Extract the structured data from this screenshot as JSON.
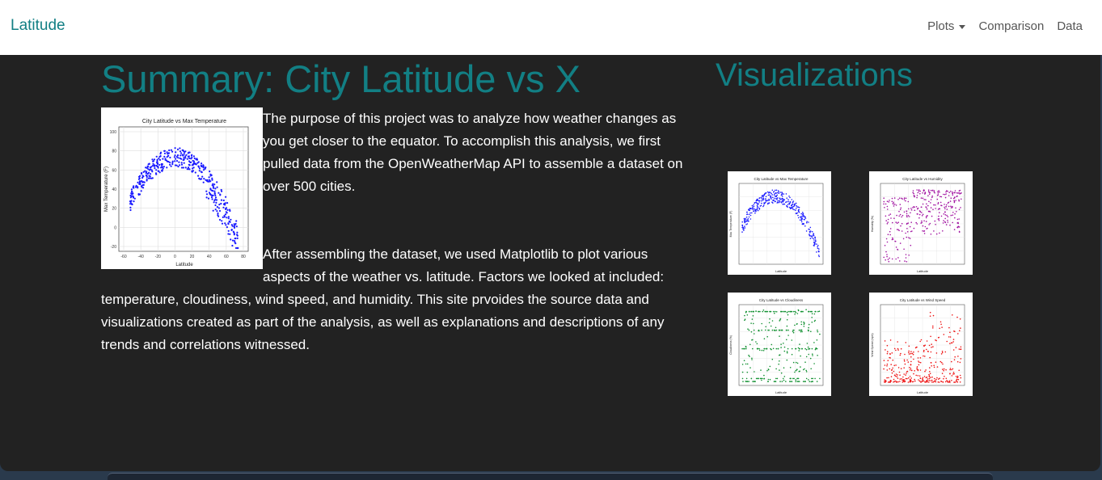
{
  "navbar": {
    "brand": "Latitude",
    "items": [
      {
        "label": "Plots",
        "dropdown": true
      },
      {
        "label": "Comparison",
        "dropdown": false
      },
      {
        "label": "Data",
        "dropdown": false
      }
    ]
  },
  "summary": {
    "title": "Summary: City Latitude vs X",
    "paragraphs": [
      "The purpose of this project was to analyze how weather changes as you get closer to the equator. To accomplish this analysis, we first pulled data from the OpenWeatherMap API to assemble a dataset on over 500 cities.",
      "After assembling the dataset, we used Matplotlib to plot various aspects of the weather vs. latitude. Factors we looked at included: temperature, cloudiness, wind speed, and humidity. This site prvoides the source data and visualizations created as part of the analysis, as well as explanations and descriptions of any trends and correlations witnessed."
    ],
    "image": {
      "title": "City Latitude vs Max Temperature",
      "xlabel": "Latitude",
      "ylabel": "Max Temperature (F)",
      "xticks": [
        "-60",
        "-40",
        "-20",
        "0",
        "20",
        "40",
        "60",
        "80"
      ],
      "yticks": [
        "100",
        "80",
        "60",
        "40",
        "20",
        "0",
        "-20"
      ],
      "color": "#1a1aff"
    }
  },
  "visualizations": {
    "title": "Visualizations",
    "thumbnails": [
      {
        "title": "City Latitude vs Max Temperature",
        "xlabel": "Latitude",
        "ylabel": "Max Temperature (F)",
        "color": "#1a1aff",
        "pattern": "temperature"
      },
      {
        "title": "City Latitude vs Humidity",
        "xlabel": "Latitude",
        "ylabel": "Humidity (%)",
        "color": "#a010a0",
        "pattern": "humidity"
      },
      {
        "title": "City Latitude vs Cloudiness",
        "xlabel": "Latitude",
        "ylabel": "Cloudiness (%)",
        "color": "#109030",
        "pattern": "cloudiness"
      },
      {
        "title": "City Latitude vs Wind Speed",
        "xlabel": "Latitude",
        "ylabel": "Wind Speed (mph)",
        "color": "#ee1111",
        "pattern": "wind"
      }
    ]
  }
}
